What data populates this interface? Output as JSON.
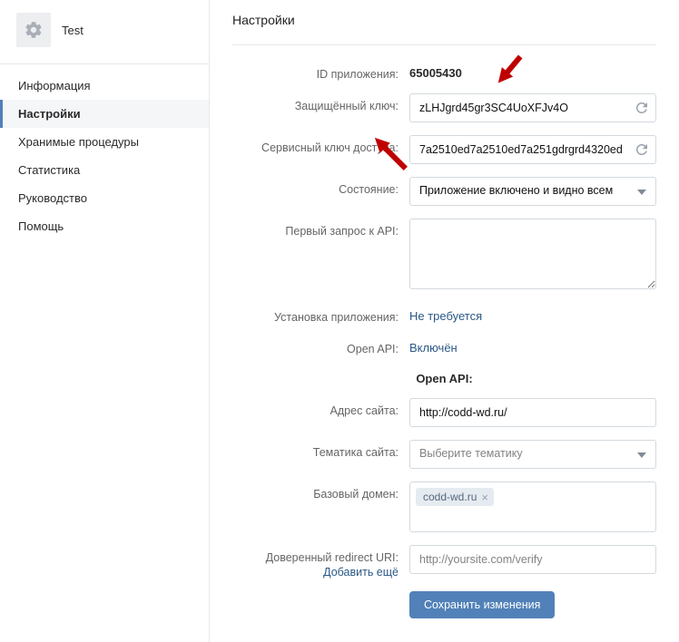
{
  "sidebar": {
    "app_name": "Test",
    "items": [
      {
        "label": "Информация",
        "active": false
      },
      {
        "label": "Настройки",
        "active": true
      },
      {
        "label": "Хранимые процедуры",
        "active": false
      },
      {
        "label": "Статистика",
        "active": false
      },
      {
        "label": "Руководство",
        "active": false
      },
      {
        "label": "Помощь",
        "active": false
      }
    ]
  },
  "page": {
    "title": "Настройки",
    "fields": {
      "app_id": {
        "label": "ID приложения:",
        "value": "65005430"
      },
      "secret_key": {
        "label": "Защищённый ключ:",
        "value": "zLHJgrd45gr3SC4UoXFJv4O"
      },
      "service_key": {
        "label": "Сервисный ключ доступа:",
        "value": "7a2510ed7a2510ed7a251gdrgrd4320ed"
      },
      "state": {
        "label": "Состояние:",
        "value": "Приложение включено и видно всем"
      },
      "first_api": {
        "label": "Первый запрос к API:",
        "value": ""
      },
      "install": {
        "label": "Установка приложения:",
        "value": "Не требуется"
      },
      "open_api": {
        "label": "Open API:",
        "value": "Включён"
      }
    },
    "open_api_section": {
      "heading": "Open API:",
      "site_url": {
        "label": "Адрес сайта:",
        "value": "http://codd-wd.ru/"
      },
      "theme": {
        "label": "Тематика сайта:",
        "placeholder": "Выберите тематику"
      },
      "base_domain": {
        "label": "Базовый домен:",
        "tag": "codd-wd.ru"
      },
      "redirect": {
        "label": "Доверенный redirect URI:",
        "placeholder": "http://yoursite.com/verify",
        "add_more": "Добавить ещё"
      }
    },
    "save_button": "Сохранить изменения"
  }
}
